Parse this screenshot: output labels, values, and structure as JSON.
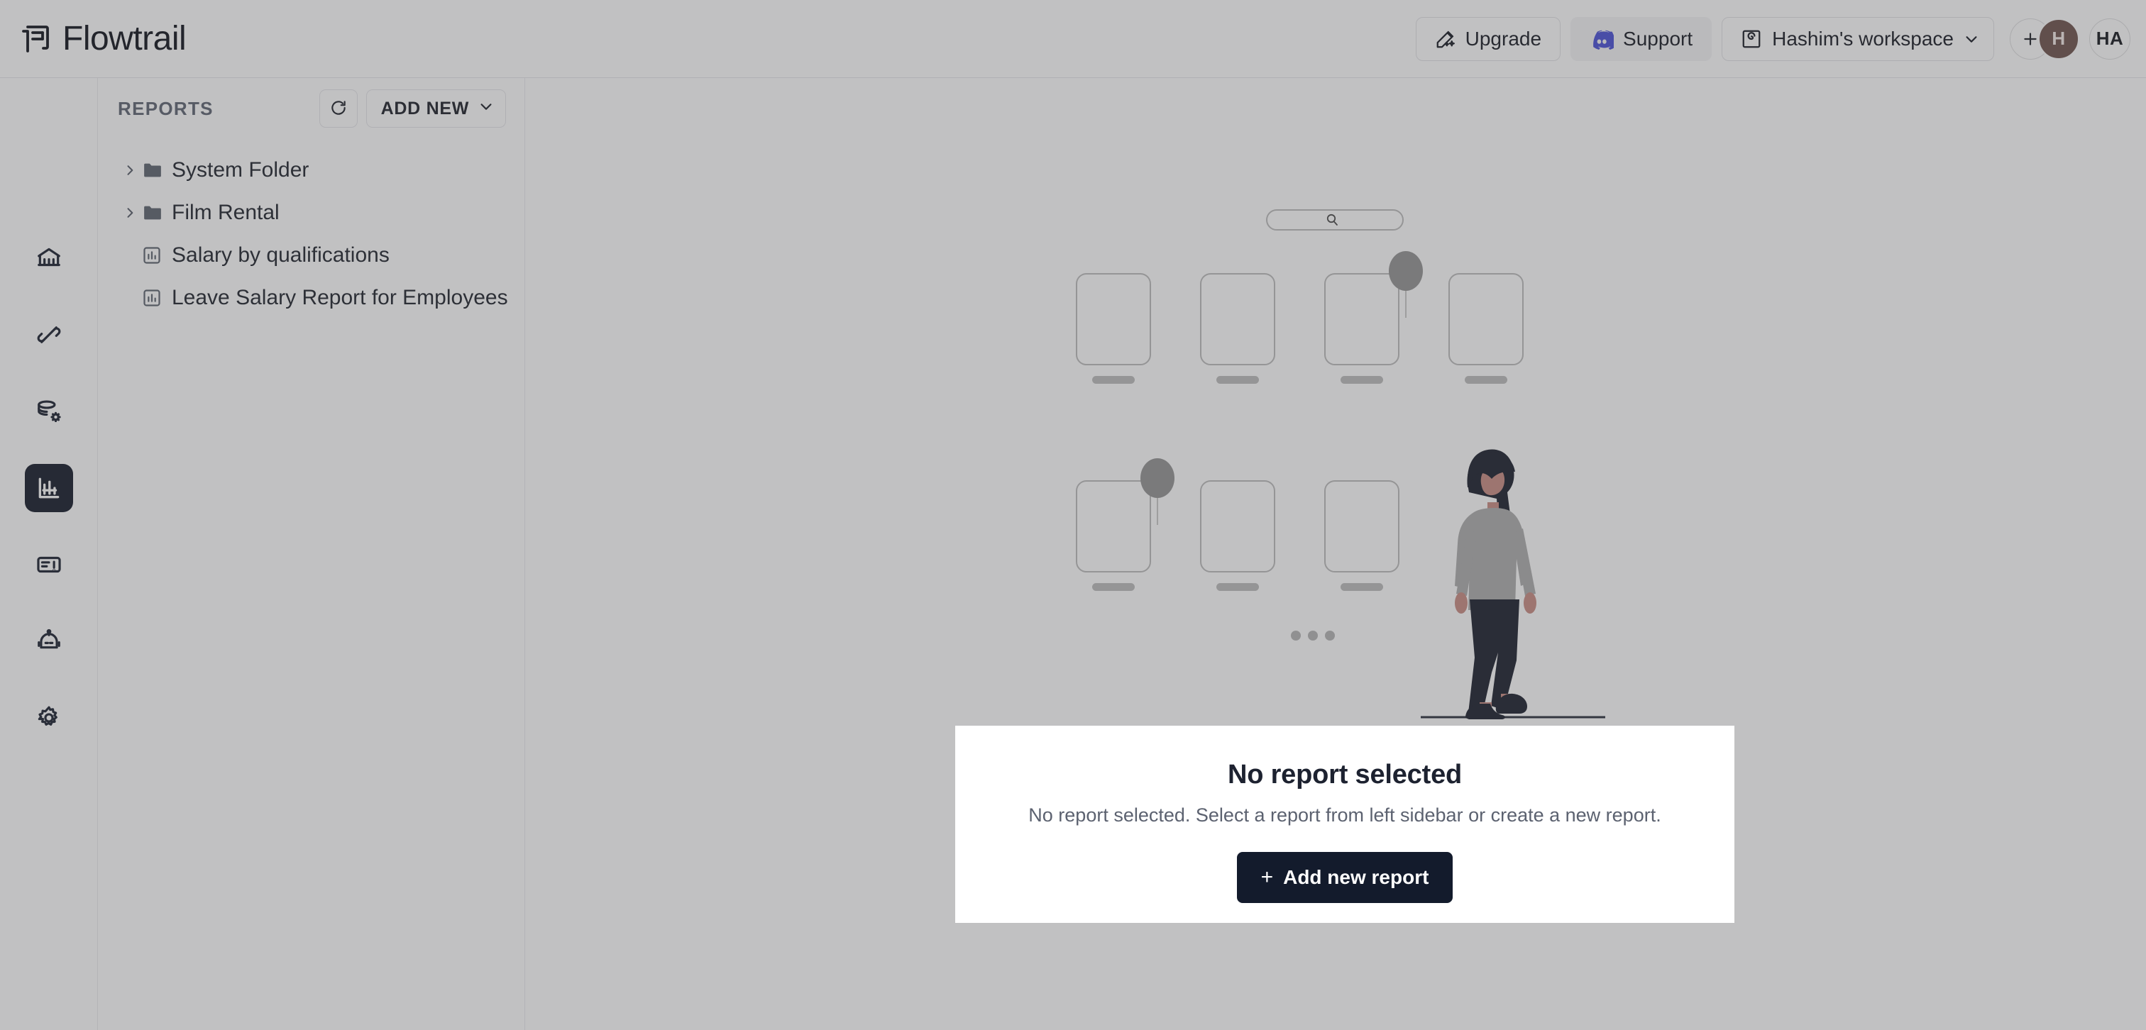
{
  "app": {
    "brand_name": "Flowtrail",
    "brand_icon": "flowtrail-logo-icon"
  },
  "header": {
    "upgrade_label": "Upgrade",
    "upgrade_icon": "magic-wand-sparkle-icon",
    "support_label": "Support",
    "support_icon": "discord-icon",
    "support_icon_color": "#4a4fd6",
    "workspace_label": "Hashim's workspace",
    "workspace_icon": "workspace-square-icon",
    "workspace_chevron_icon": "chevron-down-icon",
    "add_member_icon": "plus-icon",
    "member_avatar_initial": "H",
    "member_avatar_color": "#6e534c",
    "user_avatar_initials": "HA"
  },
  "rail": {
    "items": [
      {
        "name": "home",
        "icon": "bank-home-icon",
        "active": false
      },
      {
        "name": "connections",
        "icon": "plug-connection-icon",
        "active": false
      },
      {
        "name": "data-sources",
        "icon": "database-gear-icon",
        "active": false
      },
      {
        "name": "reports",
        "icon": "bar-chart-icon",
        "active": true
      },
      {
        "name": "dashboards",
        "icon": "layout-card-icon",
        "active": false
      },
      {
        "name": "assistant",
        "icon": "robot-icon",
        "active": false
      },
      {
        "name": "settings",
        "icon": "gear-icon",
        "active": false
      }
    ]
  },
  "sidebar": {
    "title": "REPORTS",
    "refresh_icon": "refresh-icon",
    "add_new_label": "ADD NEW",
    "add_new_chevron_icon": "chevron-down-icon",
    "tree": [
      {
        "label": "System Folder",
        "type": "folder",
        "icon": "folder-icon",
        "chevron": "chevron-right-icon",
        "expanded": false
      },
      {
        "label": "Film Rental",
        "type": "folder",
        "icon": "folder-icon",
        "chevron": "chevron-right-icon",
        "expanded": false
      },
      {
        "label": "Salary by qualifications",
        "type": "report",
        "icon": "report-chart-icon"
      },
      {
        "label": "Leave Salary Report for Employees",
        "type": "report",
        "icon": "report-chart-icon"
      }
    ]
  },
  "illustration": {
    "name": "empty-state-illustration",
    "search_icon": "search-icon",
    "cards_row1": 4,
    "cards_row2": 3,
    "dots": 3,
    "figure": "walking-woman-figure"
  },
  "modal": {
    "title": "No report selected",
    "subtitle": "No report selected. Select a report from left sidebar or create a new report.",
    "cta_plus": "+",
    "cta_label": "Add new report",
    "cta_color": "#131b2c"
  }
}
